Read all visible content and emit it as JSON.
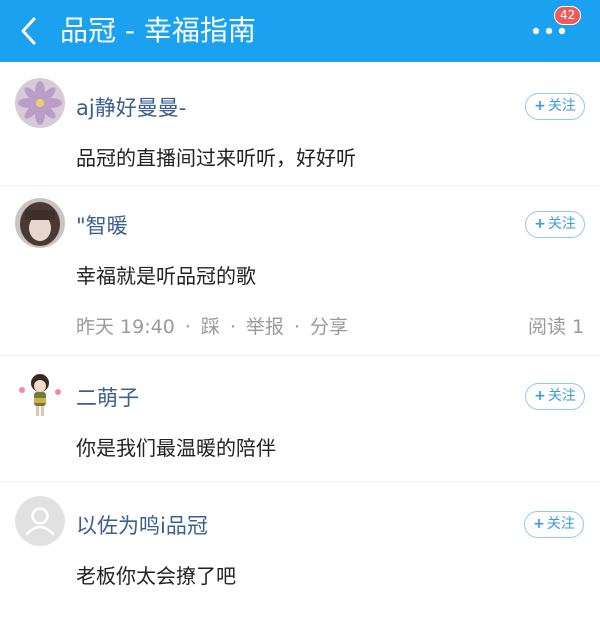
{
  "header": {
    "title": "品冠 - 幸福指南",
    "badge_count": "42",
    "bg_color": "#1aa1f0"
  },
  "comments": [
    {
      "username": "aj静好曼曼-",
      "content": "品冠的直播间过来听听，好好听",
      "follow_label": "关注"
    },
    {
      "username": "\"智暖",
      "content": "幸福就是听品冠的歌",
      "follow_label": "关注",
      "meta": {
        "time": "昨天 19:40",
        "step": "踩",
        "report": "举报",
        "share": "分享",
        "read_count": "阅读 1"
      }
    },
    {
      "username": "二萌子",
      "content": "你是我们最温暖的陪伴",
      "follow_label": "关注"
    },
    {
      "username": "以佐为鸣i品冠",
      "content": "老板你太会撩了吧",
      "follow_label": "关注"
    }
  ]
}
